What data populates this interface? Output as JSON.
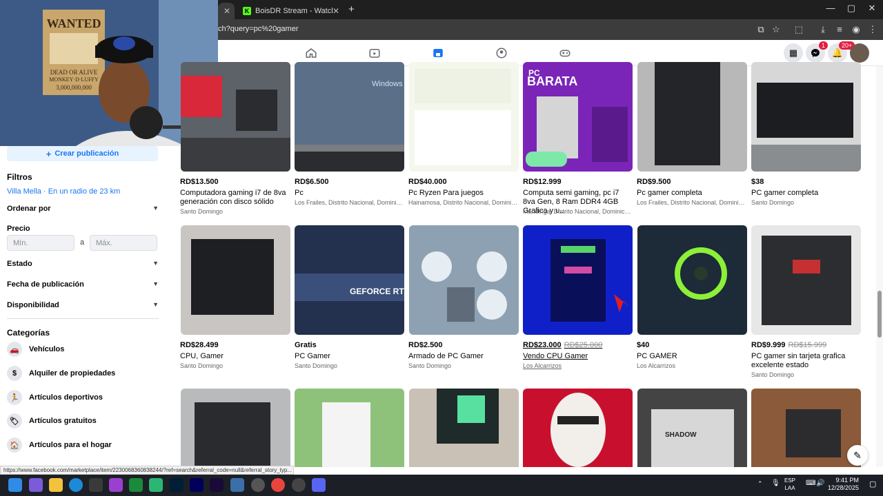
{
  "browser": {
    "tabs": [
      {
        "label": "",
        "active": true
      },
      {
        "label": "BoisDR Stream - Watch Live on",
        "active": false
      }
    ],
    "new_tab": "+",
    "url": "ch?query=pc%20gamer",
    "window_controls": [
      "—",
      "▢",
      "✕"
    ]
  },
  "fb_nav": {
    "icons": [
      "home-icon",
      "video-icon",
      "marketplace-icon",
      "groups-icon",
      "gaming-icon"
    ],
    "messenger_badge": "1",
    "notif_badge": "20+"
  },
  "sidebar": {
    "create_label": "Crear publicación",
    "create_icon": "+",
    "filters_heading": "Filtros",
    "location": "Villa Mella · En un radio de 23 km",
    "sort_label": "Ordenar por",
    "price_label": "Precio",
    "min_placeholder": "Mín.",
    "to_label": "a",
    "max_placeholder": "Máx.",
    "condition_label": "Estado",
    "date_label": "Fecha de publicación",
    "availability_label": "Disponibilidad",
    "categories_heading": "Categorías",
    "categories": [
      {
        "label": "Vehículos",
        "icon": "🚗"
      },
      {
        "label": "Alquiler de propiedades",
        "icon": "$"
      },
      {
        "label": "Artículos deportivos",
        "icon": "🏃"
      },
      {
        "label": "Artículos gratuitos",
        "icon": "🏷"
      },
      {
        "label": "Artículos para el hogar",
        "icon": "🏠"
      }
    ]
  },
  "listings": [
    {
      "price": "RD$13.500",
      "old_price": "",
      "title": "Computadora gaming i7 de 8va generación con disco sólido",
      "location": "Santo Domingo"
    },
    {
      "price": "RD$6.500",
      "old_price": "",
      "title": "Pc",
      "location": "Los Frailes, Distrito Nacional, Dominica..."
    },
    {
      "price": "RD$40.000",
      "old_price": "",
      "title": "Pc Ryzen Para juegos",
      "location": "Hainamosa, Distrito Nacional, Dominica..."
    },
    {
      "price": "RD$12.999",
      "old_price": "",
      "title": "Computa semi gaming, pc i7 8va Gen, 8 Ram DDR4 4GB Grafica y u...",
      "location": "Mandinga, Distrito Nacional, Dominican..."
    },
    {
      "price": "RD$9.500",
      "old_price": "",
      "title": "Pc gamer completa",
      "location": "Los Frailes, Distrito Nacional, Dominica..."
    },
    {
      "price": "$38",
      "old_price": "",
      "title": "PC gamer completa",
      "location": "Santo Domingo"
    },
    {
      "price": "RD$28.499",
      "old_price": "",
      "title": "CPU, Gamer",
      "location": "Santo Domingo"
    },
    {
      "price": "Gratis",
      "old_price": "",
      "title": "PC Gamer",
      "location": "Santo Domingo"
    },
    {
      "price": "RD$2.500",
      "old_price": "",
      "title": "Armado de PC Gamer",
      "location": "Santo Domingo"
    },
    {
      "price": "RD$23.000",
      "old_price": "RD$25.000",
      "title": "Vendo CPU Gamer",
      "location": "Los Alcarrizos"
    },
    {
      "price": "$40",
      "old_price": "",
      "title": "PC GAMER",
      "location": "Los Alcarrizos"
    },
    {
      "price": "RD$9.999",
      "old_price": "RD$15.999",
      "title": "PC gamer sin tarjeta grafica excelente estado",
      "location": "Santo Domingo"
    }
  ],
  "image_texts": {
    "windows": "Windows",
    "barata_pc": "PC",
    "barata": "BARATA",
    "geforce": "GEFORCE RTX",
    "shadow": "SHADOW",
    "wanted": "WANTED",
    "dead_or_alive": "DEAD OR ALIVE",
    "luffy": "MONKEY·D·LUFFY",
    "bounty": "3,000,000,000",
    "barata_specs": "I7 8TH\nRS 340\n2GB\nLGA 1151\nHDD 500GB\nDDR4 8GB\n500W"
  },
  "status_url": "https://www.facebook.com/marketplace/item/2230068360838244/?ref=search&referral_code=null&referral_story_typ...",
  "taskbar": {
    "lang_top": "ESP",
    "lang_bottom": "LAA",
    "time": "9:41 PM",
    "date": "12/28/2025"
  },
  "colors": {
    "accent": "#1877f2",
    "badge": "#e41e3f",
    "kick_green": "#53fc18"
  }
}
